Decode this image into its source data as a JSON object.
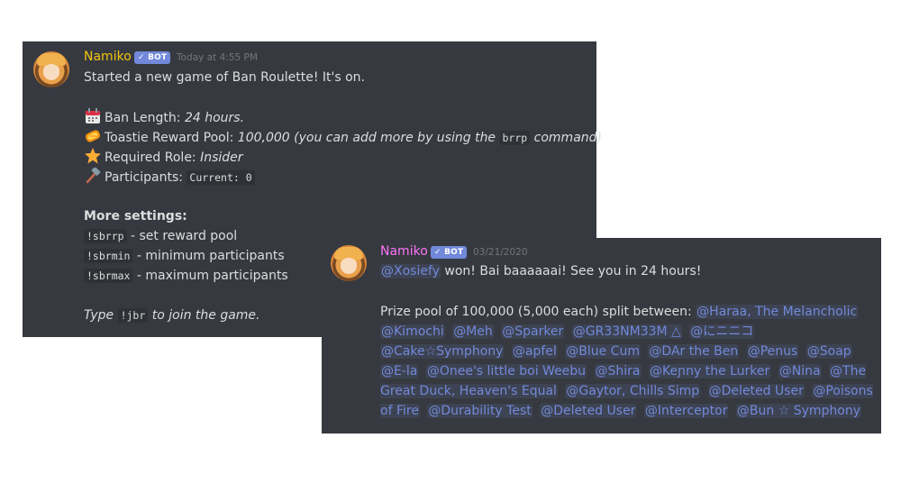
{
  "message1": {
    "username": "Namiko",
    "username_color": "#f1c40f",
    "badge": "✓ BOT",
    "timestamp": "Today at 4:55 PM",
    "intro": "Started a new game of Ban Roulette! It's on.",
    "ban_length_label": "Ban Length: ",
    "ban_length_value": "24 hours.",
    "reward_label": "Toastie Reward Pool: ",
    "reward_value": "100,000 (you can add more by using the ",
    "reward_cmd": "brrp",
    "reward_end": " command)",
    "role_label": "Required Role: ",
    "role_value": "Insider",
    "participants_label": "Participants: ",
    "participants_value": "Current: 0",
    "more_settings": "More settings:",
    "cmd1": "!sbrrp",
    "cmd1_desc": " - set reward pool",
    "cmd2": "!sbrmin",
    "cmd2_desc": " - minimum participants",
    "cmd3": "!sbrmax",
    "cmd3_desc": " - maximum participants",
    "type_prefix": "Type ",
    "type_cmd": "!jbr",
    "type_suffix": " to join the game.",
    "icons": [
      "calendar-icon",
      "toast-icon",
      "star-icon",
      "hammer-icon"
    ]
  },
  "message2": {
    "username": "Namiko",
    "username_color": "#ff73fa",
    "badge": "✓ BOT",
    "timestamp": "03/21/2020",
    "winner": "@Xosiefy",
    "winner_text": " won! Bai baaaaaai! See you in 24 hours!",
    "prize_text": "Prize pool of 100,000 (5,000 each) split between: ",
    "mentions": [
      "@Haraa, The Melancholic",
      "@Kimochi",
      "@Meh",
      "@Sparker",
      "@GR33NM33M △",
      "@にニニコ",
      "@Cake☆Symphony",
      "@apfel",
      "@Blue Cum",
      "@DAr the Ben",
      "@Penus",
      "@Soap",
      "@E-la",
      "@Onee's little boi Weebu",
      "@Shira",
      "@Keɲny the Lurker",
      "@Nina",
      "@The Great Duck, Heaven's Equal",
      "@Gaytor, Chills Simp",
      "@Deleted User",
      "@Poisons of Fire",
      "@Durability Test",
      "@Deleted User",
      "@Interceptor",
      "@Bun ☆ Symphony"
    ],
    "mention_color": "#7289da"
  }
}
